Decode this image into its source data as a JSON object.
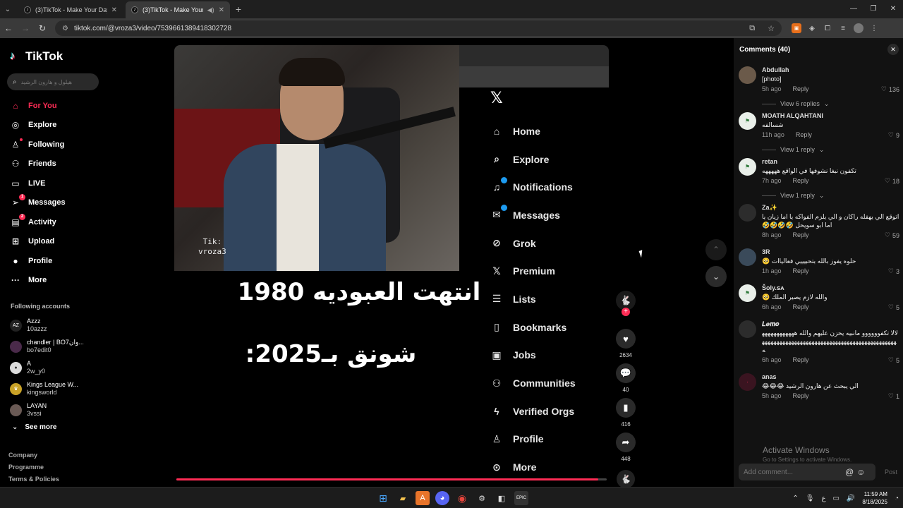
{
  "browser": {
    "tabs": [
      {
        "title": "(3)TikTok - Make Your Day",
        "active": false
      },
      {
        "title": "(3)TikTok - Make Your Day",
        "active": true
      }
    ],
    "url": "tiktok.com/@vroza3/video/7539661389418302728"
  },
  "sidebar": {
    "logo_text": "TikTok",
    "search_placeholder": "هيلول و هارون الرشيد",
    "nav": [
      {
        "label": "For You",
        "icon": "home-icon",
        "active": true
      },
      {
        "label": "Explore",
        "icon": "compass-icon"
      },
      {
        "label": "Following",
        "icon": "following-icon"
      },
      {
        "label": "Friends",
        "icon": "friends-icon"
      },
      {
        "label": "LIVE",
        "icon": "live-icon"
      },
      {
        "label": "Messages",
        "icon": "messages-icon",
        "badge": "1"
      },
      {
        "label": "Activity",
        "icon": "activity-icon",
        "badge": "2"
      },
      {
        "label": "Upload",
        "icon": "upload-icon"
      },
      {
        "label": "Profile",
        "icon": "profile-icon"
      },
      {
        "label": "More",
        "icon": "more-icon"
      }
    ],
    "following_title": "Following accounts",
    "following": [
      {
        "name": "Azzz",
        "handle": "10azzz"
      },
      {
        "name": "chandler | BO7وان...",
        "handle": "bo7edit0"
      },
      {
        "name": "A",
        "handle": "2w_y0"
      },
      {
        "name": "Kings League W...",
        "handle": "kingsworld"
      },
      {
        "name": "LAYAN",
        "handle": "3vssi"
      }
    ],
    "see_more": "See more",
    "footer": [
      "Company",
      "Programme",
      "Terms & Policies"
    ]
  },
  "video": {
    "watermark_line1": "Tik:",
    "watermark_line2": "vroza3",
    "x_menu": [
      "Home",
      "Explore",
      "Notifications",
      "Messages",
      "Grok",
      "Premium",
      "Lists",
      "Bookmarks",
      "Jobs",
      "Communities",
      "Verified Orgs",
      "Profile",
      "More"
    ],
    "caption_line1": "انتهت العبوديه 1980",
    "caption_line2": "شونق بـ2025:",
    "progress": 0.98
  },
  "actions": {
    "likes": "2634",
    "comments": "40",
    "saves": "416",
    "shares": "448"
  },
  "comments": {
    "header": "Comments (40)",
    "reply_label": "Reply",
    "items": [
      {
        "user": "Abdullah",
        "text": "[photo]",
        "time": "5h ago",
        "likes": "136",
        "replies": "View 6 replies"
      },
      {
        "user": "MOATH ALQAHTANI",
        "text": "شسالفه",
        "time": "11h ago",
        "likes": "9",
        "replies": "View 1 reply"
      },
      {
        "user": "retan",
        "text": "تكفون نبغا نشوفها في الواقع هههههه",
        "time": "7h ago",
        "likes": "18",
        "replies": "View 1 reply"
      },
      {
        "user": "Za✨",
        "text": "اتوقع الي يهفله راكان و الي يلزم الفواكه يا اما زيان يا اما ابو سويحل 🤣🤣🤣🤣",
        "time": "8h ago",
        "likes": "59",
        "replies": ""
      },
      {
        "user": "3R",
        "text": "حلوه يفوز بالله بتحبيييي فعالياات 🥺",
        "time": "1h ago",
        "likes": "3",
        "replies": ""
      },
      {
        "user": "Šoly.ꜱᴀ",
        "text": "والله لازم يصير الملك 🥺",
        "time": "6h ago",
        "likes": "5",
        "replies": ""
      },
      {
        "user": "𝑳𝒆𝒎𝒐",
        "text": "لالا تكفوووووو مانبيه يحزن عليهم والله ههههههههههههههههههههههههههههههههههههههههههههههههههههههههههه",
        "time": "6h ago",
        "likes": "5",
        "replies": ""
      },
      {
        "user": "anas",
        "text": "الي يبحث عن هارون الرشيد 😂😂😂",
        "time": "5h ago",
        "likes": "1",
        "replies": ""
      }
    ],
    "input_placeholder": "Add comment...",
    "post_label": "Post"
  },
  "watermark": {
    "line1": "Activate Windows",
    "line2": "Go to Settings to activate Windows."
  },
  "taskbar": {
    "time": "11:59 AM",
    "date": "8/18/2025",
    "lang": "ع"
  }
}
